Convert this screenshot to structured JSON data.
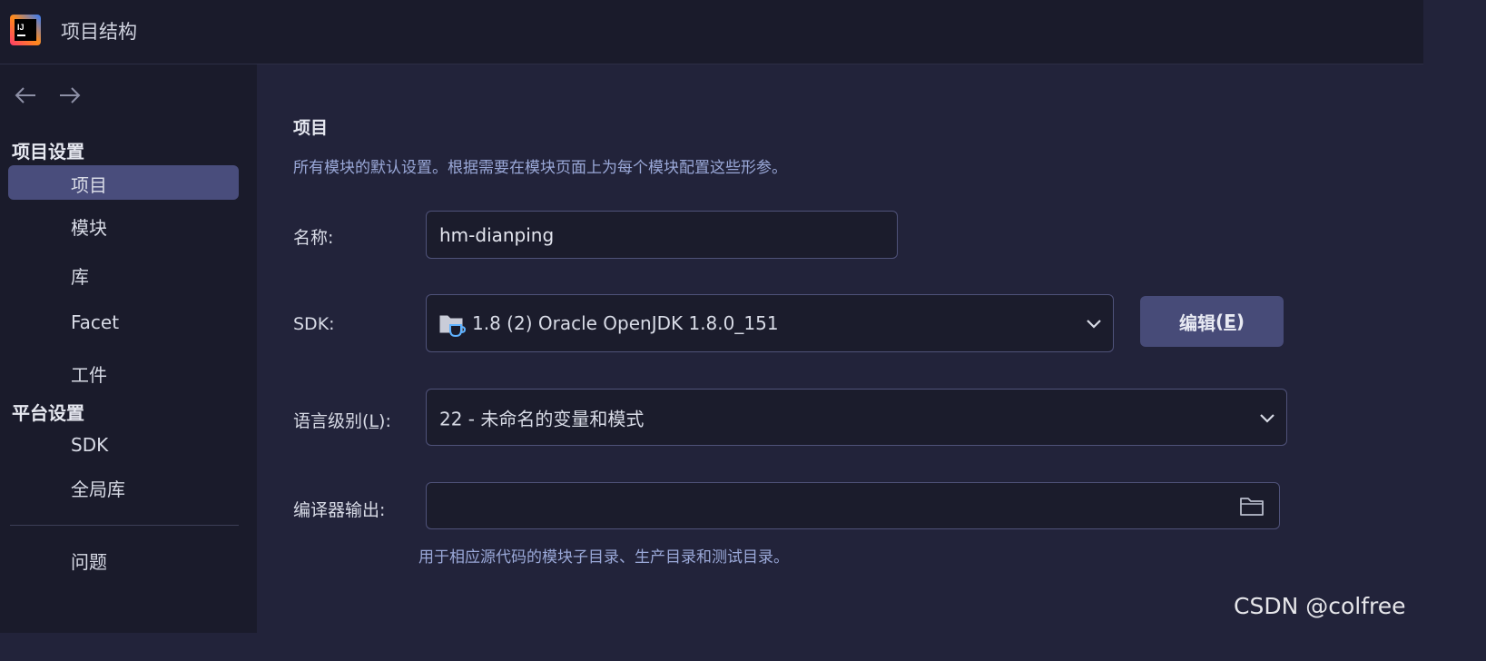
{
  "window": {
    "title": "项目结构"
  },
  "sidebar": {
    "project_settings_header": "项目设置",
    "platform_settings_header": "平台设置",
    "project_items": [
      {
        "label": "项目",
        "selected": true
      },
      {
        "label": "模块"
      },
      {
        "label": "库"
      },
      {
        "label": "Facet"
      },
      {
        "label": "工件"
      }
    ],
    "platform_items": [
      {
        "label": "SDK"
      },
      {
        "label": "全局库"
      }
    ],
    "problems_label": "问题"
  },
  "main": {
    "title": "项目",
    "description": "所有模块的默认设置。根据需要在模块页面上为每个模块配置这些形参。",
    "name_label": "名称:",
    "name_value": "hm-dianping",
    "sdk_label": "SDK:",
    "sdk_value": "1.8 (2) Oracle OpenJDK 1.8.0_151",
    "edit_button_label": "编辑",
    "edit_button_mnemonic": "E",
    "language_level_label": "语言级别",
    "language_level_mnemonic": "L",
    "language_level_value": "22 - 未命名的变量和模式",
    "compiler_output_label": "编译器输出:",
    "compiler_output_value": "",
    "compiler_output_hint": "用于相应源代码的模块子目录、生产目录和测试目录。"
  },
  "watermark": "CSDN @colfree",
  "colors": {
    "background": "#22233a",
    "sidebar": "#1a1b2b",
    "selected_item": "#494d7c",
    "field_border": "#4f5279",
    "description_text": "#9aa8d8"
  },
  "icons": [
    "intellij-logo-icon",
    "back-arrow-icon",
    "forward-arrow-icon",
    "sdk-folder-icon",
    "chevron-down-icon",
    "folder-browse-icon"
  ]
}
